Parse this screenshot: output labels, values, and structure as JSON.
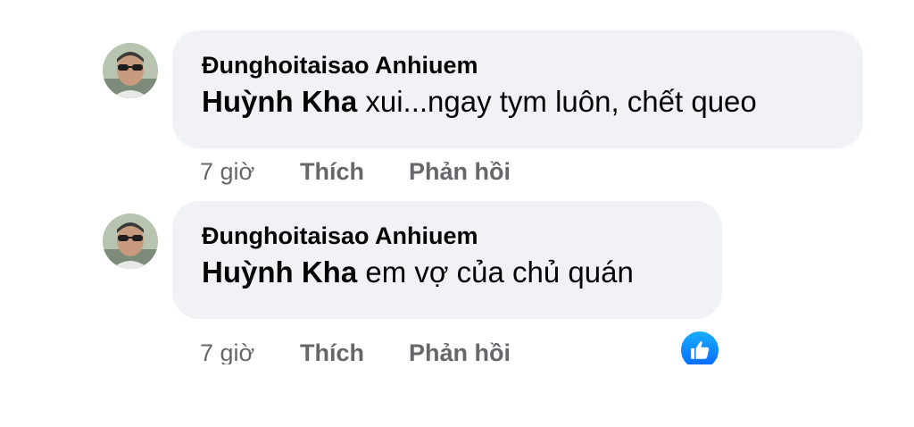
{
  "comments": [
    {
      "author": "Đunghoitaisao Anhiuem",
      "mention": "Huỳnh Kha",
      "text": " xui...ngay tym luôn, chết queo",
      "time": "7 giờ",
      "like_label": "Thích",
      "reply_label": "Phản hồi"
    },
    {
      "author": "Đunghoitaisao Anhiuem",
      "mention": "Huỳnh Kha",
      "text": " em vợ của chủ quán",
      "time": "7 giờ",
      "like_label": "Thích",
      "reply_label": "Phản hồi"
    }
  ],
  "reaction": {
    "icon": "thumbs-up-icon",
    "color": "#0866ff"
  }
}
